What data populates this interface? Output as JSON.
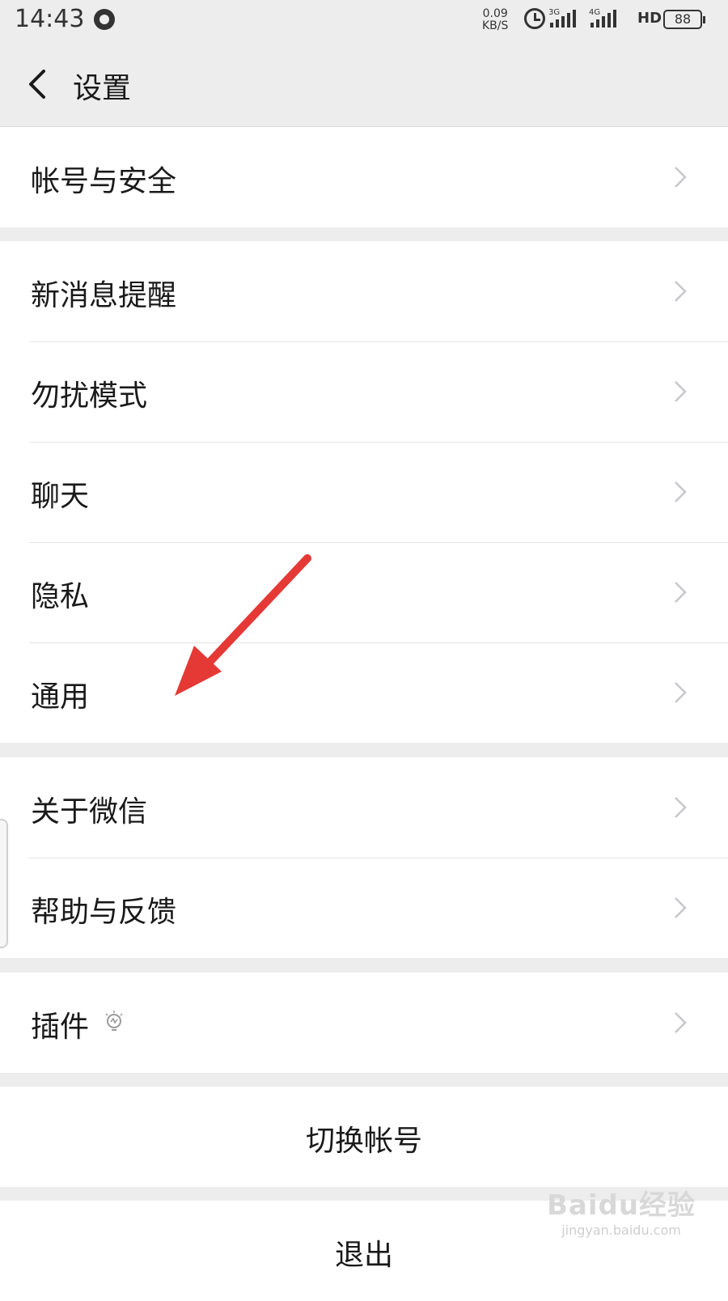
{
  "status_bar": {
    "time": "14:43",
    "net_speed_value": "0.09",
    "net_speed_unit": "KB/S",
    "signal_1_tag": "3G",
    "signal_2_tag": "4G",
    "hd_label": "HD",
    "battery": "88"
  },
  "nav": {
    "title": "设置",
    "back_icon": "chevron-left-icon"
  },
  "groups": [
    {
      "items": [
        {
          "label": "帐号与安全"
        }
      ]
    },
    {
      "items": [
        {
          "label": "新消息提醒"
        },
        {
          "label": "勿扰模式"
        },
        {
          "label": "聊天"
        },
        {
          "label": "隐私"
        },
        {
          "label": "通用"
        }
      ]
    },
    {
      "items": [
        {
          "label": "关于微信"
        },
        {
          "label": "帮助与反馈"
        }
      ]
    },
    {
      "items": [
        {
          "label": "插件",
          "icon": "lightbulb-icon"
        }
      ]
    }
  ],
  "actions": {
    "switch_account": "切换帐号",
    "logout": "退出"
  },
  "annotation": {
    "arrow_color": "#e53935",
    "arrow_target": "通用"
  },
  "watermark": {
    "logo": "Baidu经验",
    "url": "jingyan.baidu.com"
  },
  "colors": {
    "background": "#ededed",
    "cell": "#ffffff",
    "text": "#1a1a1a",
    "chevron": "#c7c7cc"
  }
}
